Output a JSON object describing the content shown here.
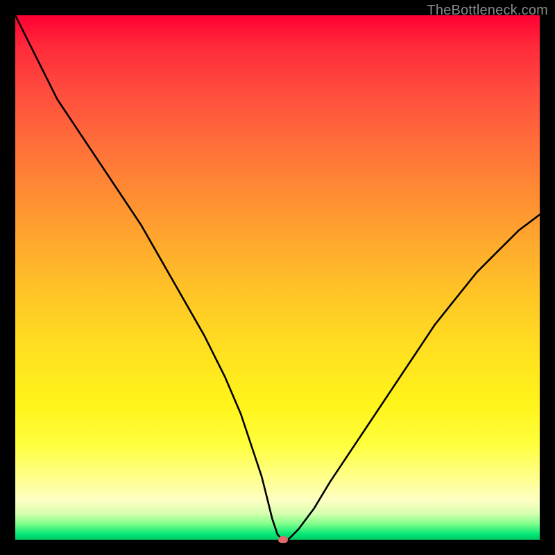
{
  "watermark": "TheBottleneck.com",
  "colors": {
    "dot": "#e06a6a"
  },
  "chart_data": {
    "type": "line",
    "title": "",
    "xlabel": "",
    "ylabel": "",
    "ylim": [
      0,
      100
    ],
    "x": [
      0,
      2,
      5,
      8,
      12,
      16,
      20,
      24,
      28,
      32,
      36,
      40,
      43,
      45,
      47,
      48,
      49,
      50,
      51,
      52,
      54,
      57,
      60,
      64,
      68,
      72,
      76,
      80,
      84,
      88,
      92,
      96,
      100
    ],
    "values": [
      100,
      96,
      90,
      84,
      78,
      72,
      66,
      60,
      53,
      46,
      39,
      31,
      24,
      18,
      12,
      8,
      4,
      1,
      0,
      0,
      2,
      6,
      11,
      17,
      23,
      29,
      35,
      41,
      46,
      51,
      55,
      59,
      62
    ],
    "marker": {
      "x": 51,
      "y": 0
    },
    "annotations": []
  }
}
